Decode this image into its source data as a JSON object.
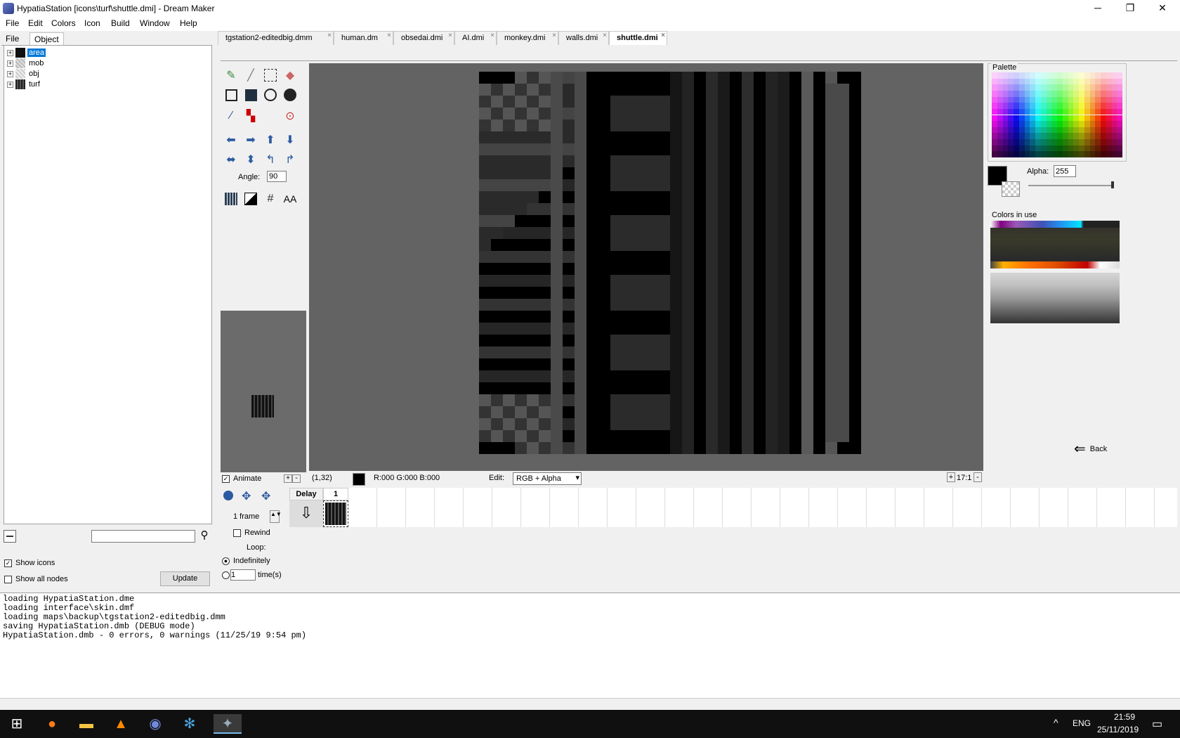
{
  "window": {
    "title": "HypatiaStation [icons\\turf\\shuttle.dmi] - Dream Maker",
    "minimize": "─",
    "restore": "❐",
    "close": "✕"
  },
  "menu": [
    "File",
    "Edit",
    "Colors",
    "Icon",
    "Build",
    "Window",
    "Help"
  ],
  "left": {
    "tabs": [
      "File",
      "Object"
    ],
    "tree": [
      {
        "label": "area",
        "color": "#101010",
        "selected": true
      },
      {
        "label": "mob",
        "color": "#c8c8c8"
      },
      {
        "label": "obj",
        "color": "#d8d8d8"
      },
      {
        "label": "turf",
        "color": "#3a3a3a"
      }
    ],
    "show_icons": "Show icons",
    "show_all_nodes": "Show all nodes",
    "update": "Update",
    "search_placeholder": ""
  },
  "tabs": [
    "tgstation2-editedbig.dmm",
    "human.dm",
    "obsedai.dmi",
    "AI.dmi",
    "monkey.dmi",
    "walls.dmi",
    "shuttle.dmi"
  ],
  "active_tab": "shuttle.dmi",
  "tools": {
    "angle_label": "Angle:",
    "angle_value": "90",
    "aa_label": "AA"
  },
  "preview": {
    "animate": "Animate",
    "plus": "+",
    "minus": "-"
  },
  "status": {
    "coords": "(1,32)",
    "rgb": "R:000 G:000 B:000",
    "edit_label": "Edit:",
    "edit_mode": "RGB + Alpha",
    "zoom": "17:1"
  },
  "right": {
    "palette_label": "Palette",
    "alpha_label": "Alpha:",
    "alpha_value": "255",
    "colors_in_use": "Colors in use",
    "back": "Back"
  },
  "timeline": {
    "delay": "Delay",
    "frame_col": "1",
    "frames": "1 frame",
    "rewind": "Rewind",
    "loop": "Loop:",
    "indefinitely": "Indefinitely",
    "times_value": "1",
    "times_label": "time(s)"
  },
  "output": [
    "loading HypatiaStation.dme",
    "loading interface\\skin.dmf",
    "loading maps\\backup\\tgstation2-editedbig.dmm",
    "saving HypatiaStation.dmb (DEBUG mode)",
    "HypatiaStation.dmb - 0 errors, 0 warnings (11/25/19 9:54 pm)"
  ],
  "taskbar": {
    "time": "21:59",
    "date": "25/11/2019",
    "lang": "ENG"
  }
}
